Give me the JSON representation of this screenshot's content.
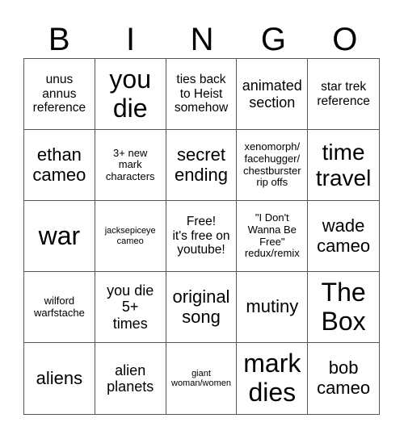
{
  "header": {
    "letters": [
      "B",
      "I",
      "N",
      "G",
      "O"
    ]
  },
  "cells": [
    {
      "text": "unus\nannus\nreference",
      "size": "md"
    },
    {
      "text": "you\ndie",
      "size": "huge"
    },
    {
      "text": "ties back\nto Heist\nsomehow",
      "size": "md"
    },
    {
      "text": "animated\nsection",
      "size": "lg"
    },
    {
      "text": "star trek\nreference",
      "size": "md"
    },
    {
      "text": "ethan\ncameo",
      "size": "xl"
    },
    {
      "text": "3+ new\nmark\ncharacters",
      "size": "sm"
    },
    {
      "text": "secret\nending",
      "size": "xl"
    },
    {
      "text": "xenomorph/\nfacehugger/\nchestburster\nrip offs",
      "size": "sm"
    },
    {
      "text": "time\ntravel",
      "size": "xxl"
    },
    {
      "text": "war",
      "size": "huge"
    },
    {
      "text": "jacksepiceye\ncameo",
      "size": "xs"
    },
    {
      "text": "Free!\nit's free on\nyoutube!",
      "size": "md"
    },
    {
      "text": "\"I Don't\nWanna Be\nFree\"\nredux/remix",
      "size": "sm"
    },
    {
      "text": "wade\ncameo",
      "size": "xl"
    },
    {
      "text": "wilford\nwarfstache",
      "size": "sm"
    },
    {
      "text": "you die\n5+\ntimes",
      "size": "lg"
    },
    {
      "text": "original\nsong",
      "size": "xl"
    },
    {
      "text": "mutiny",
      "size": "xl"
    },
    {
      "text": "The\nBox",
      "size": "huge"
    },
    {
      "text": "aliens",
      "size": "xl"
    },
    {
      "text": "alien\nplanets",
      "size": "lg"
    },
    {
      "text": "giant\nwoman/women",
      "size": "xs"
    },
    {
      "text": "mark\ndies",
      "size": "huge"
    },
    {
      "text": "bob\ncameo",
      "size": "xl"
    }
  ]
}
